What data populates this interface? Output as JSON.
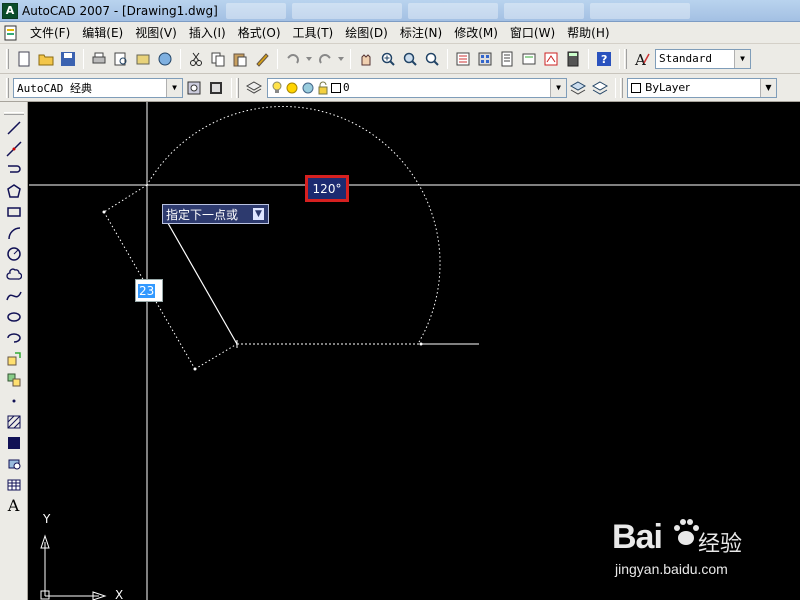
{
  "window": {
    "title": "AutoCAD 2007 - [Drawing1.dwg]"
  },
  "menu": [
    {
      "label": "文件(F)"
    },
    {
      "label": "编辑(E)"
    },
    {
      "label": "视图(V)"
    },
    {
      "label": "插入(I)"
    },
    {
      "label": "格式(O)"
    },
    {
      "label": "工具(T)"
    },
    {
      "label": "绘图(D)"
    },
    {
      "label": "标注(N)"
    },
    {
      "label": "修改(M)"
    },
    {
      "label": "窗口(W)"
    },
    {
      "label": "帮助(H)"
    }
  ],
  "toolbar": {
    "text_style": "Standard",
    "workspace": "AutoCAD 经典",
    "layer": "0",
    "color": "ByLayer"
  },
  "drawbar": {
    "text_tool": "A"
  },
  "canvas": {
    "tooltip": "指定下一点或",
    "angle": "120°",
    "length": "23",
    "ucs_x": "X",
    "ucs_y": "Y"
  },
  "watermark": {
    "logo": "Bai",
    "brand": "经验",
    "url": "jingyan.baidu.com"
  },
  "colors": {
    "canvas_bg": "#000000",
    "angle_highlight": "#d62020",
    "input_selection": "#3399ff"
  }
}
